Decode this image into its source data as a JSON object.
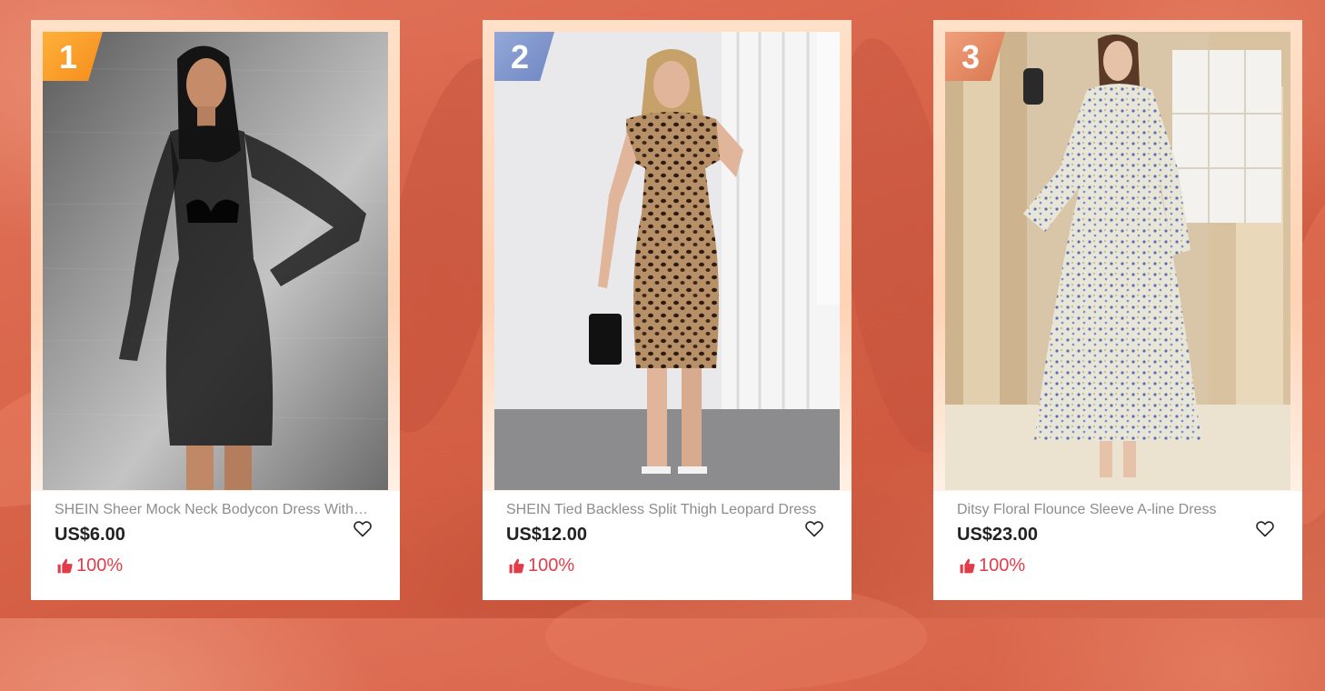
{
  "colors": {
    "rank_1": [
      "#ffb03a",
      "#f58d1c"
    ],
    "rank_2": [
      "#94a9d8",
      "#6f86c2"
    ],
    "rank_3": [
      "#f0a07c",
      "#d9774f"
    ],
    "accent_red": "#e23c4b"
  },
  "products": [
    {
      "rank": "1",
      "title": "SHEIN Sheer Mock Neck Bodycon Dress Without Bra",
      "price": "US$6.00",
      "rating": "100%",
      "wishlist_icon": "heart-outline-icon",
      "rating_icon": "thumbs-up-icon",
      "image": "black-sheer-bodycon-dress-model-photo"
    },
    {
      "rank": "2",
      "title": "SHEIN Tied Backless Split Thigh Leopard Dress",
      "price": "US$12.00",
      "rating": "100%",
      "wishlist_icon": "heart-outline-icon",
      "rating_icon": "thumbs-up-icon",
      "image": "leopard-print-split-dress-model-photo"
    },
    {
      "rank": "3",
      "title": "Ditsy Floral Flounce Sleeve A-line Dress",
      "price": "US$23.00",
      "rating": "100%",
      "wishlist_icon": "heart-outline-icon",
      "rating_icon": "thumbs-up-icon",
      "image": "floral-flounce-sleeve-dress-model-photo"
    }
  ]
}
